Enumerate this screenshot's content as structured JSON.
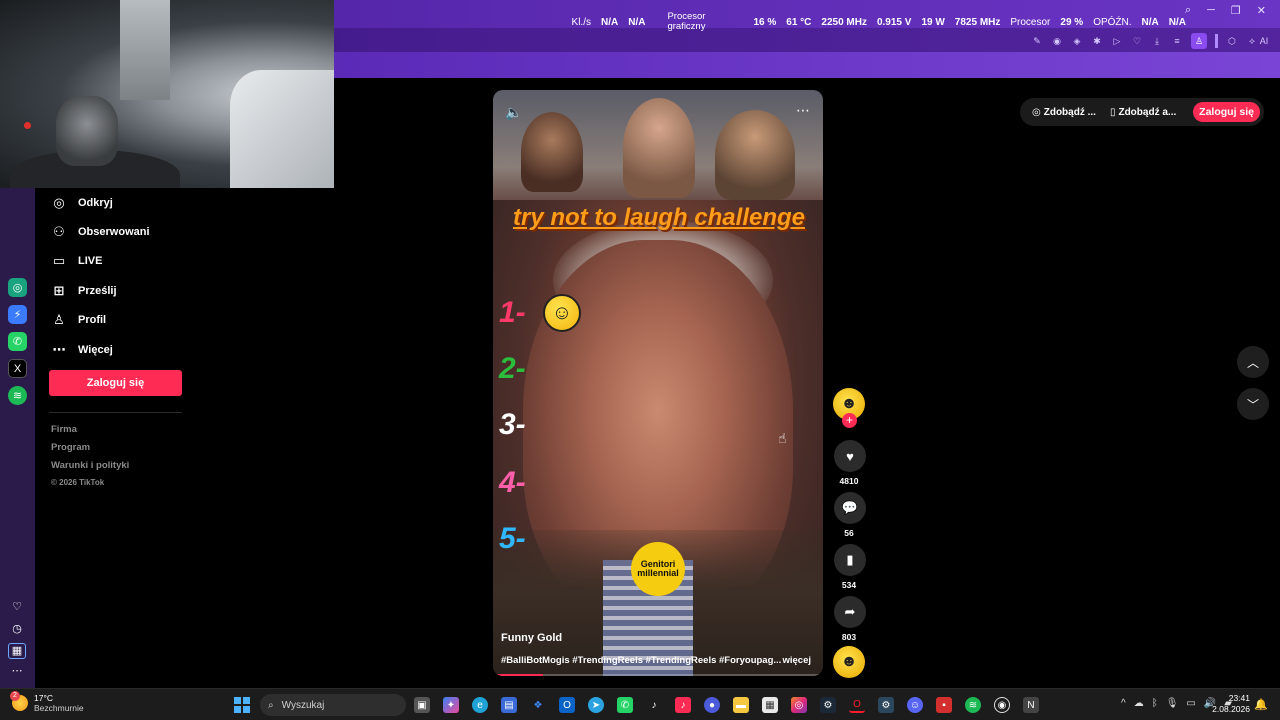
{
  "overlay": {
    "fps_label": "Kl./s",
    "fps_value1": "N/A",
    "fps_value2": "N/A",
    "gpu_label_1": "Procesor",
    "gpu_label_2": "graficzny",
    "gpu_load": "16 %",
    "gpu_temp": "61 °C",
    "gpu_clock": "2250 MHz",
    "gpu_voltage": "0.915 V",
    "gpu_power": "19 W",
    "gpu_mem_clock": "7825 MHz",
    "cpu_label": "Procesor",
    "cpu_load": "29 %",
    "latency_label": "OPÓŹN.",
    "latency_value1": "N/A",
    "latency_value2": "N/A",
    "ai_label": "AI"
  },
  "sidebar": {
    "items": [
      {
        "label": "Odkryj",
        "icon": "compass-icon"
      },
      {
        "label": "Obserwowani",
        "icon": "following-icon"
      },
      {
        "label": "LIVE",
        "icon": "live-tv-icon"
      },
      {
        "label": "Prześlij",
        "icon": "upload-plus-icon"
      },
      {
        "label": "Profil",
        "icon": "profile-icon"
      },
      {
        "label": "Więcej",
        "icon": "more-dots-icon"
      }
    ],
    "login_label": "Zaloguj się",
    "footer": {
      "firma": "Firma",
      "program": "Program",
      "terms": "Warunki i polityki",
      "copyright": "© 2026 TikTok"
    }
  },
  "header": {
    "get_app_1": "Zdobądź ...",
    "get_app_2": "Zdobądź a...",
    "login_label": "Zaloguj się"
  },
  "video": {
    "title_overlay": "try not to laugh challenge",
    "numbers": [
      "1-",
      "2-",
      "3-",
      "4-",
      "5-"
    ],
    "number_colors": [
      "#ff3a6a",
      "#2dbd3c",
      "#ffffff",
      "#ff5fa8",
      "#2fb8ff"
    ],
    "badge_text": "Genitori millennial",
    "author": "Funny Gold",
    "hashtags": "#BalliBotMogis #TrendingReels #TrendingReels #Foryoupag...",
    "more_label": "więcej",
    "progress": 0.15
  },
  "actions": {
    "likes": "4810",
    "comments": "56",
    "saves": "534",
    "shares": "803"
  },
  "taskbar": {
    "temp": "17°C",
    "weather": "Bezchmurnie",
    "weather_badge": "2",
    "search_placeholder": "Wyszukaj",
    "time": "23:41",
    "date": "2.08.2026"
  }
}
